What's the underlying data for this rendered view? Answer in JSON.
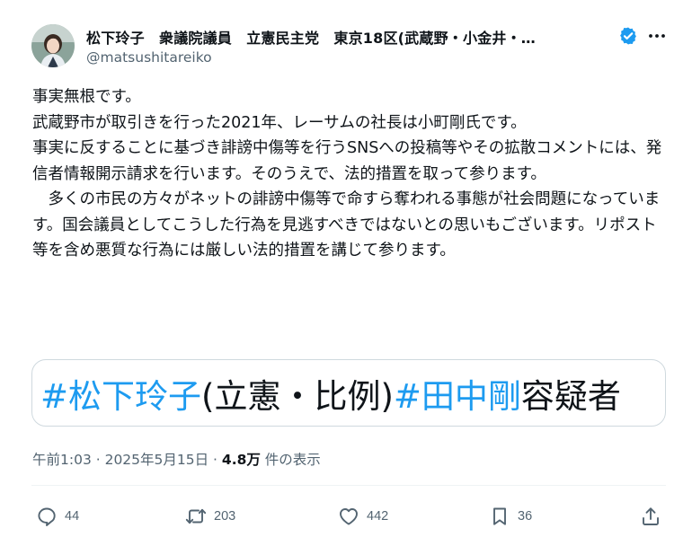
{
  "tweet": {
    "display_name": "松下玲子　衆議院議員　立憲民主党　東京18区(武蔵野・小金井・…",
    "handle": "@matsushitareiko",
    "paragraphs": [
      "事実無根です。",
      "武蔵野市が取引きを行った2021年、レーサムの社長は小町剛氏です。",
      "事実に反することに基づき誹謗中傷等を行うSNSへの投稿等やその拡散コメントには、発信者情報開示請求を行います。そのうえで、法的措置を取って参ります。",
      "　多くの市民の方々がネットの誹謗中傷等で命すら奪われる事態が社会問題になっています。国会議員としてこうした行為を見逃すべきではないとの思いもございます。リポスト等を含め悪質な行為には厳しい法的措置を講じて参ります。"
    ],
    "card": {
      "tag1": "#松下玲子",
      "text1": "(立憲・比例) ",
      "tag2": "#田中剛",
      "text2": " 容疑者"
    },
    "timestamp": "午前1:03 · 2025年5月15日 · ",
    "views_count": "4.8万",
    "views_label": " 件の表示"
  },
  "actions": {
    "reply_count": "44",
    "repost_count": "203",
    "like_count": "442",
    "bookmark_count": "36"
  },
  "icons": {
    "reply": "reply-icon",
    "repost": "repost-icon",
    "like": "heart-icon",
    "bookmark": "bookmark-icon",
    "share": "share-icon",
    "verified": "verified-badge-icon",
    "more": "more-options-icon"
  },
  "colors": {
    "accent": "#1d9bf0",
    "text": "#0f1419",
    "secondary": "#536471",
    "border": "#cfd9de"
  }
}
